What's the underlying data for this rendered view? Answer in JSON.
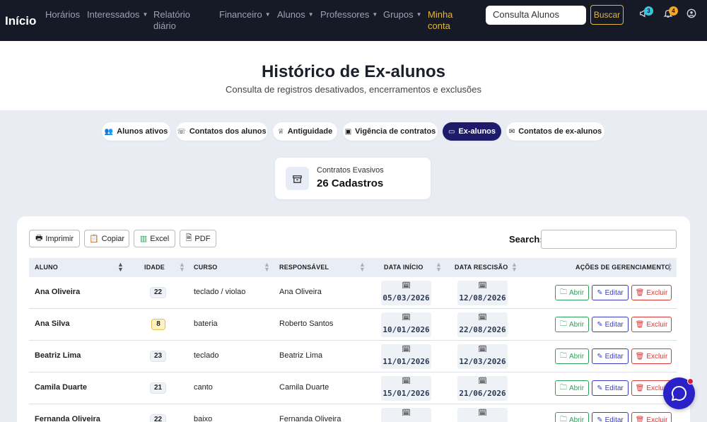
{
  "nav": {
    "brand": "Início",
    "links": [
      "Horários",
      "Interessados",
      "Relatório",
      "diário",
      "Financeiro",
      "Alunos",
      "Professores",
      "Grupos",
      "Minha",
      "conta"
    ],
    "search_value": "Consulta Alunos",
    "search_button": "Buscar",
    "badges": {
      "megaphone": "3",
      "bell": "4"
    },
    "colors": {
      "bg": "#151a26",
      "accent": "#e6b43a"
    }
  },
  "header": {
    "title": "Histórico de Ex-alunos",
    "subtitle": "Consulta de registros desativados, encerramentos e exclusões"
  },
  "tabs": [
    {
      "label": "Alunos ativos",
      "icon": "users-icon"
    },
    {
      "label": "Contatos dos alunos",
      "icon": "phone-icon"
    },
    {
      "label": "Antiguidade",
      "icon": "trophy-icon"
    },
    {
      "label": "Vigência de contratos",
      "icon": "calendar-icon"
    },
    {
      "label": "Ex-alunos",
      "icon": "archive-icon",
      "active": true
    },
    {
      "label": "Contatos de ex-alunos",
      "icon": "mail-icon"
    }
  ],
  "stat": {
    "label": "Contratos Evasivos",
    "value": "26 Cadastros"
  },
  "toolbar": {
    "buttons": [
      "Imprimir",
      "Copiar",
      "Excel",
      "PDF"
    ],
    "search_label": "Search:"
  },
  "table": {
    "columns": [
      "ALUNO",
      "IDADE",
      "CURSO",
      "RESPONSÁVEL",
      "DATA INÍCIO",
      "DATA RESCISÃO",
      "AÇÕES DE GERENCIAMENTO"
    ],
    "actions": {
      "open": "Abrir",
      "edit": "Editar",
      "delete": "Excluir"
    },
    "rows": [
      {
        "aluno": "Ana Oliveira",
        "idade": "22",
        "curso": "teclado / violao",
        "responsavel": "Ana Oliveira",
        "inicio": "05/03/2026",
        "rescisao": "12/08/2026"
      },
      {
        "aluno": "Ana Silva",
        "idade": "8",
        "curso": "bateria",
        "responsavel": "Roberto Santos",
        "inicio": "10/01/2026",
        "rescisao": "22/08/2026",
        "minor": true
      },
      {
        "aluno": "Beatriz Lima",
        "idade": "23",
        "curso": "teclado",
        "responsavel": "Beatriz Lima",
        "inicio": "11/01/2026",
        "rescisao": "12/03/2026"
      },
      {
        "aluno": "Camila Duarte",
        "idade": "21",
        "curso": "canto",
        "responsavel": "Camila Duarte",
        "inicio": "15/01/2026",
        "rescisao": "21/06/2026"
      },
      {
        "aluno": "Fernanda Oliveira",
        "idade": "22",
        "curso": "baixo",
        "responsavel": "Fernanda Oliveira",
        "inicio": "",
        "rescisao": ""
      }
    ]
  }
}
